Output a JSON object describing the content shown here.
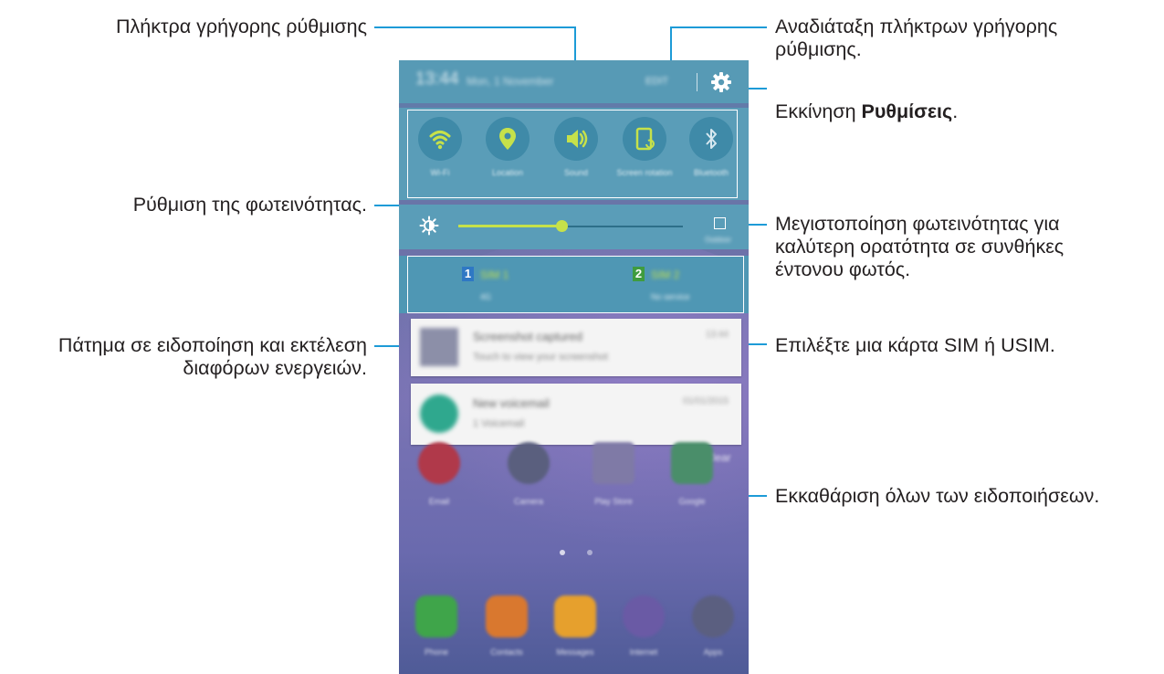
{
  "callouts": {
    "quick_setting_buttons": "Πλήκτρα γρήγορης ρύθμισης",
    "rearrange_buttons": "Αναδιάταξη πλήκτρων γρήγορης\nρύθμισης.",
    "launch_settings_prefix": "Εκκίνηση ",
    "launch_settings_bold": "Ρυθμίσεις",
    "launch_settings_suffix": ".",
    "adjust_brightness": "Ρύθμιση της φωτεινότητας.",
    "maximize_brightness": "Μεγιστοποίηση φωτεινότητας για\nκαλύτερη ορατότητα σε συνθήκες\nέντονου φωτός.",
    "tap_notification": "Πάτημα σε ειδοποίηση και εκτέλεση\nδιαφόρων ενεργειών.",
    "select_sim": "Επιλέξτε μια κάρτα SIM ή USIM.",
    "clear_notifications": "Εκκαθάριση όλων των ειδοποιήσεων."
  },
  "status_bar": {
    "time": "13:44",
    "date": "Mon, 1 November",
    "edit_label": "EDIT"
  },
  "quick_settings": [
    {
      "icon": "wifi-icon",
      "label": "Wi-Fi"
    },
    {
      "icon": "location-icon",
      "label": "Location"
    },
    {
      "icon": "sound-icon",
      "label": "Sound"
    },
    {
      "icon": "screen-rotation-icon",
      "label": "Screen rotation"
    },
    {
      "icon": "bluetooth-icon",
      "label": "Bluetooth"
    }
  ],
  "brightness": {
    "level_percent": 46,
    "outdoor_label": "Outdoor"
  },
  "sim_cards": [
    {
      "number": "1",
      "name": "SIM 1",
      "status": "4G",
      "badge_color": "#2f78c4"
    },
    {
      "number": "2",
      "name": "SIM 2",
      "status": "No service",
      "badge_color": "#3f9c3f"
    }
  ],
  "notifications": [
    {
      "title": "Screenshot captured",
      "subtitle": "Touch to view your screenshot",
      "time": "13:44"
    },
    {
      "title": "New voicemail",
      "subtitle": "1 Voicemail",
      "time": "01/01/2015"
    }
  ],
  "clear_label": "Clear",
  "apps_row": [
    {
      "label": "Email",
      "icon": "email-app-icon",
      "color": "#c0392b"
    },
    {
      "label": "Camera",
      "icon": "camera-app-icon",
      "color": "#555c80"
    },
    {
      "label": "Play Store",
      "icon": "play-store-app-icon",
      "color": "#6a6a9a"
    },
    {
      "label": "Google",
      "icon": "google-folder-icon",
      "color": "#2e8b57"
    }
  ],
  "dock": [
    {
      "label": "Phone",
      "icon": "phone-app-icon",
      "color": "#3fae49"
    },
    {
      "label": "Contacts",
      "icon": "contacts-app-icon",
      "color": "#e07a2e"
    },
    {
      "label": "Messages",
      "icon": "messages-app-icon",
      "color": "#e8a22a"
    },
    {
      "label": "Internet",
      "icon": "internet-app-icon",
      "color": "#6b5ca8"
    },
    {
      "label": "Apps",
      "icon": "apps-icon",
      "color": "#5a5f82"
    }
  ],
  "colors": {
    "leader_line": "#1d9bd7",
    "panel": "#5a9db8",
    "accent": "#c6e14a"
  }
}
